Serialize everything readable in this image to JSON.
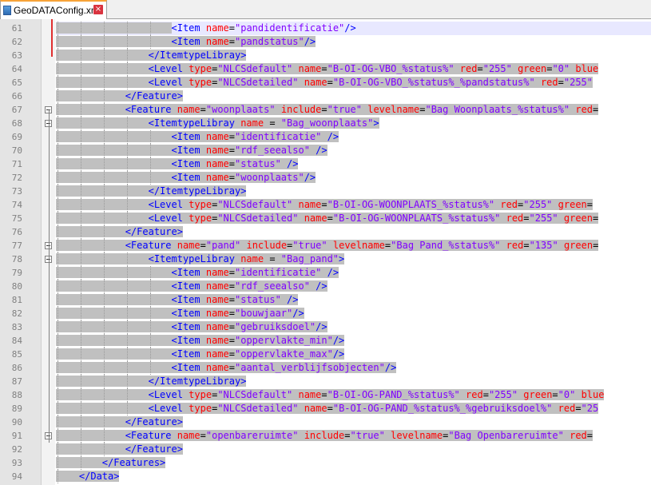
{
  "tab": {
    "title": "GeoDATAConfig.xml",
    "close_icon": "×"
  },
  "lines": [
    {
      "n": "61",
      "indent": 5,
      "code": [
        [
          "t",
          "<Item "
        ],
        [
          "a",
          "name"
        ],
        [
          "p",
          "="
        ],
        [
          "v",
          "\"pandidentificatie\""
        ],
        [
          "t",
          "/>"
        ]
      ]
    },
    {
      "n": "62",
      "indent": 5,
      "code": [
        [
          "t",
          "<Item "
        ],
        [
          "a",
          "name"
        ],
        [
          "p",
          "="
        ],
        [
          "v",
          "\"pandstatus\""
        ],
        [
          "t",
          "/>"
        ]
      ]
    },
    {
      "n": "63",
      "indent": 4,
      "code": [
        [
          "t",
          "</ItemtypeLibray>"
        ]
      ]
    },
    {
      "n": "64",
      "indent": 4,
      "code": [
        [
          "t",
          "<Level "
        ],
        [
          "a",
          "type"
        ],
        [
          "p",
          "="
        ],
        [
          "v",
          "\"NLCSdefault\""
        ],
        [
          "p",
          " "
        ],
        [
          "a",
          "name"
        ],
        [
          "p",
          "="
        ],
        [
          "v",
          "\"B-OI-OG-VBO_%status%\""
        ],
        [
          "p",
          " "
        ],
        [
          "a",
          "red"
        ],
        [
          "p",
          "="
        ],
        [
          "v",
          "\"255\""
        ],
        [
          "p",
          " "
        ],
        [
          "a",
          "green"
        ],
        [
          "p",
          "="
        ],
        [
          "v",
          "\"0\""
        ],
        [
          "p",
          " "
        ],
        [
          "a",
          "blue"
        ]
      ]
    },
    {
      "n": "65",
      "indent": 4,
      "code": [
        [
          "t",
          "<Level "
        ],
        [
          "a",
          "type"
        ],
        [
          "p",
          "="
        ],
        [
          "v",
          "\"NLCSdetailed\""
        ],
        [
          "p",
          " "
        ],
        [
          "a",
          "name"
        ],
        [
          "p",
          "="
        ],
        [
          "v",
          "\"B-OI-OG-VBO_%status%_%pandstatus%\""
        ],
        [
          "p",
          " "
        ],
        [
          "a",
          "red"
        ],
        [
          "p",
          "="
        ],
        [
          "v",
          "\"255\""
        ]
      ]
    },
    {
      "n": "66",
      "indent": 3,
      "code": [
        [
          "t",
          "</Feature>"
        ]
      ]
    },
    {
      "n": "67",
      "indent": 3,
      "code": [
        [
          "t",
          "<Feature "
        ],
        [
          "a",
          "name"
        ],
        [
          "p",
          "="
        ],
        [
          "v",
          "\"woonplaats\""
        ],
        [
          "p",
          " "
        ],
        [
          "a",
          "include"
        ],
        [
          "p",
          "="
        ],
        [
          "v",
          "\"true\""
        ],
        [
          "p",
          " "
        ],
        [
          "a",
          "levelname"
        ],
        [
          "p",
          "="
        ],
        [
          "v",
          "\"Bag Woonplaats_%status%\""
        ],
        [
          "p",
          " "
        ],
        [
          "a",
          "red"
        ],
        [
          "p",
          "="
        ]
      ]
    },
    {
      "n": "68",
      "indent": 4,
      "code": [
        [
          "t",
          "<ItemtypeLibray "
        ],
        [
          "a",
          "name"
        ],
        [
          "p",
          " = "
        ],
        [
          "v",
          "\"Bag_woonplaats\""
        ],
        [
          "t",
          ">"
        ]
      ]
    },
    {
      "n": "69",
      "indent": 5,
      "code": [
        [
          "t",
          "<Item "
        ],
        [
          "a",
          "name"
        ],
        [
          "p",
          "="
        ],
        [
          "v",
          "\"identificatie\""
        ],
        [
          "t",
          " />"
        ]
      ]
    },
    {
      "n": "70",
      "indent": 5,
      "code": [
        [
          "t",
          "<Item "
        ],
        [
          "a",
          "name"
        ],
        [
          "p",
          "="
        ],
        [
          "v",
          "\"rdf_seealso\""
        ],
        [
          "t",
          " />"
        ]
      ]
    },
    {
      "n": "71",
      "indent": 5,
      "code": [
        [
          "t",
          "<Item "
        ],
        [
          "a",
          "name"
        ],
        [
          "p",
          "="
        ],
        [
          "v",
          "\"status\""
        ],
        [
          "t",
          " />"
        ]
      ]
    },
    {
      "n": "72",
      "indent": 5,
      "code": [
        [
          "t",
          "<Item "
        ],
        [
          "a",
          "name"
        ],
        [
          "p",
          "="
        ],
        [
          "v",
          "\"woonplaats\""
        ],
        [
          "t",
          "/>"
        ]
      ]
    },
    {
      "n": "73",
      "indent": 4,
      "code": [
        [
          "t",
          "</ItemtypeLibray>"
        ]
      ]
    },
    {
      "n": "74",
      "indent": 4,
      "code": [
        [
          "t",
          "<Level "
        ],
        [
          "a",
          "type"
        ],
        [
          "p",
          "="
        ],
        [
          "v",
          "\"NLCSdefault\""
        ],
        [
          "p",
          " "
        ],
        [
          "a",
          "name"
        ],
        [
          "p",
          "="
        ],
        [
          "v",
          "\"B-OI-OG-WOONPLAATS_%status%\""
        ],
        [
          "p",
          " "
        ],
        [
          "a",
          "red"
        ],
        [
          "p",
          "="
        ],
        [
          "v",
          "\"255\""
        ],
        [
          "p",
          " "
        ],
        [
          "a",
          "green"
        ],
        [
          "p",
          "="
        ]
      ]
    },
    {
      "n": "75",
      "indent": 4,
      "code": [
        [
          "t",
          "<Level "
        ],
        [
          "a",
          "type"
        ],
        [
          "p",
          "="
        ],
        [
          "v",
          "\"NLCSdetailed\""
        ],
        [
          "p",
          " "
        ],
        [
          "a",
          "name"
        ],
        [
          "p",
          "="
        ],
        [
          "v",
          "\"B-OI-OG-WOONPLAATS_%status%\""
        ],
        [
          "p",
          " "
        ],
        [
          "a",
          "red"
        ],
        [
          "p",
          "="
        ],
        [
          "v",
          "\"255\""
        ],
        [
          "p",
          " "
        ],
        [
          "a",
          "green"
        ],
        [
          "p",
          "="
        ]
      ]
    },
    {
      "n": "76",
      "indent": 3,
      "code": [
        [
          "t",
          "</Feature>"
        ]
      ]
    },
    {
      "n": "77",
      "indent": 3,
      "code": [
        [
          "t",
          "<Feature "
        ],
        [
          "a",
          "name"
        ],
        [
          "p",
          "="
        ],
        [
          "v",
          "\"pand\""
        ],
        [
          "p",
          " "
        ],
        [
          "a",
          "include"
        ],
        [
          "p",
          "="
        ],
        [
          "v",
          "\"true\""
        ],
        [
          "p",
          " "
        ],
        [
          "a",
          "levelname"
        ],
        [
          "p",
          "="
        ],
        [
          "v",
          "\"Bag Pand_%status%\""
        ],
        [
          "p",
          " "
        ],
        [
          "a",
          "red"
        ],
        [
          "p",
          "="
        ],
        [
          "v",
          "\"135\""
        ],
        [
          "p",
          " "
        ],
        [
          "a",
          "green"
        ],
        [
          "p",
          "="
        ]
      ]
    },
    {
      "n": "78",
      "indent": 4,
      "code": [
        [
          "t",
          "<ItemtypeLibray "
        ],
        [
          "a",
          "name"
        ],
        [
          "p",
          " = "
        ],
        [
          "v",
          "\"Bag_pand\""
        ],
        [
          "t",
          ">"
        ]
      ]
    },
    {
      "n": "79",
      "indent": 5,
      "code": [
        [
          "t",
          "<Item "
        ],
        [
          "a",
          "name"
        ],
        [
          "p",
          "="
        ],
        [
          "v",
          "\"identificatie\""
        ],
        [
          "t",
          " />"
        ]
      ]
    },
    {
      "n": "80",
      "indent": 5,
      "code": [
        [
          "t",
          "<Item "
        ],
        [
          "a",
          "name"
        ],
        [
          "p",
          "="
        ],
        [
          "v",
          "\"rdf_seealso\""
        ],
        [
          "t",
          " />"
        ]
      ]
    },
    {
      "n": "81",
      "indent": 5,
      "code": [
        [
          "t",
          "<Item "
        ],
        [
          "a",
          "name"
        ],
        [
          "p",
          "="
        ],
        [
          "v",
          "\"status\""
        ],
        [
          "t",
          " />"
        ]
      ]
    },
    {
      "n": "82",
      "indent": 5,
      "code": [
        [
          "t",
          "<Item "
        ],
        [
          "a",
          "name"
        ],
        [
          "p",
          "="
        ],
        [
          "v",
          "\"bouwjaar\""
        ],
        [
          "t",
          "/>"
        ]
      ]
    },
    {
      "n": "83",
      "indent": 5,
      "code": [
        [
          "t",
          "<Item "
        ],
        [
          "a",
          "name"
        ],
        [
          "p",
          "="
        ],
        [
          "v",
          "\"gebruiksdoel\""
        ],
        [
          "t",
          "/>"
        ]
      ]
    },
    {
      "n": "84",
      "indent": 5,
      "code": [
        [
          "t",
          "<Item "
        ],
        [
          "a",
          "name"
        ],
        [
          "p",
          "="
        ],
        [
          "v",
          "\"oppervlakte_min\""
        ],
        [
          "t",
          "/>"
        ]
      ]
    },
    {
      "n": "85",
      "indent": 5,
      "code": [
        [
          "t",
          "<Item "
        ],
        [
          "a",
          "name"
        ],
        [
          "p",
          "="
        ],
        [
          "v",
          "\"oppervlakte_max\""
        ],
        [
          "t",
          "/>"
        ]
      ]
    },
    {
      "n": "86",
      "indent": 5,
      "code": [
        [
          "t",
          "<Item "
        ],
        [
          "a",
          "name"
        ],
        [
          "p",
          "="
        ],
        [
          "v",
          "\"aantal_verblijfsobjecten\""
        ],
        [
          "t",
          "/>"
        ]
      ]
    },
    {
      "n": "87",
      "indent": 4,
      "code": [
        [
          "t",
          "</ItemtypeLibray>"
        ]
      ]
    },
    {
      "n": "88",
      "indent": 4,
      "code": [
        [
          "t",
          "<Level "
        ],
        [
          "a",
          "type"
        ],
        [
          "p",
          "="
        ],
        [
          "v",
          "\"NLCSdefault\""
        ],
        [
          "p",
          " "
        ],
        [
          "a",
          "name"
        ],
        [
          "p",
          "="
        ],
        [
          "v",
          "\"B-OI-OG-PAND_%status%\""
        ],
        [
          "p",
          " "
        ],
        [
          "a",
          "red"
        ],
        [
          "p",
          "="
        ],
        [
          "v",
          "\"255\""
        ],
        [
          "p",
          " "
        ],
        [
          "a",
          "green"
        ],
        [
          "p",
          "="
        ],
        [
          "v",
          "\"0\""
        ],
        [
          "p",
          " "
        ],
        [
          "a",
          "blue"
        ]
      ]
    },
    {
      "n": "89",
      "indent": 4,
      "code": [
        [
          "t",
          "<Level "
        ],
        [
          "a",
          "type"
        ],
        [
          "p",
          "="
        ],
        [
          "v",
          "\"NLCSdetailed\""
        ],
        [
          "p",
          " "
        ],
        [
          "a",
          "name"
        ],
        [
          "p",
          "="
        ],
        [
          "v",
          "\"B-OI-OG-PAND_%status%_%gebruiksdoel%\""
        ],
        [
          "p",
          " "
        ],
        [
          "a",
          "red"
        ],
        [
          "p",
          "="
        ],
        [
          "v",
          "\"25"
        ]
      ]
    },
    {
      "n": "90",
      "indent": 3,
      "code": [
        [
          "t",
          "</Feature>"
        ]
      ]
    },
    {
      "n": "91",
      "indent": 3,
      "code": [
        [
          "t",
          "<Feature "
        ],
        [
          "a",
          "name"
        ],
        [
          "p",
          "="
        ],
        [
          "v",
          "\"openbareruimte\""
        ],
        [
          "p",
          " "
        ],
        [
          "a",
          "include"
        ],
        [
          "p",
          "="
        ],
        [
          "v",
          "\"true\""
        ],
        [
          "p",
          " "
        ],
        [
          "a",
          "levelname"
        ],
        [
          "p",
          "="
        ],
        [
          "v",
          "\"Bag Openbareruimte\""
        ],
        [
          "p",
          " "
        ],
        [
          "a",
          "red"
        ],
        [
          "p",
          "="
        ]
      ]
    },
    {
      "n": "92",
      "indent": 3,
      "code": [
        [
          "t",
          "</Feature>"
        ]
      ]
    },
    {
      "n": "93",
      "indent": 2,
      "code": [
        [
          "t",
          "</Features>"
        ]
      ]
    },
    {
      "n": "94",
      "indent": 1,
      "code": [
        [
          "t",
          "</Data>"
        ]
      ]
    }
  ],
  "fold_markers": [
    "67",
    "68",
    "77",
    "78",
    "91"
  ],
  "current_line": "61"
}
